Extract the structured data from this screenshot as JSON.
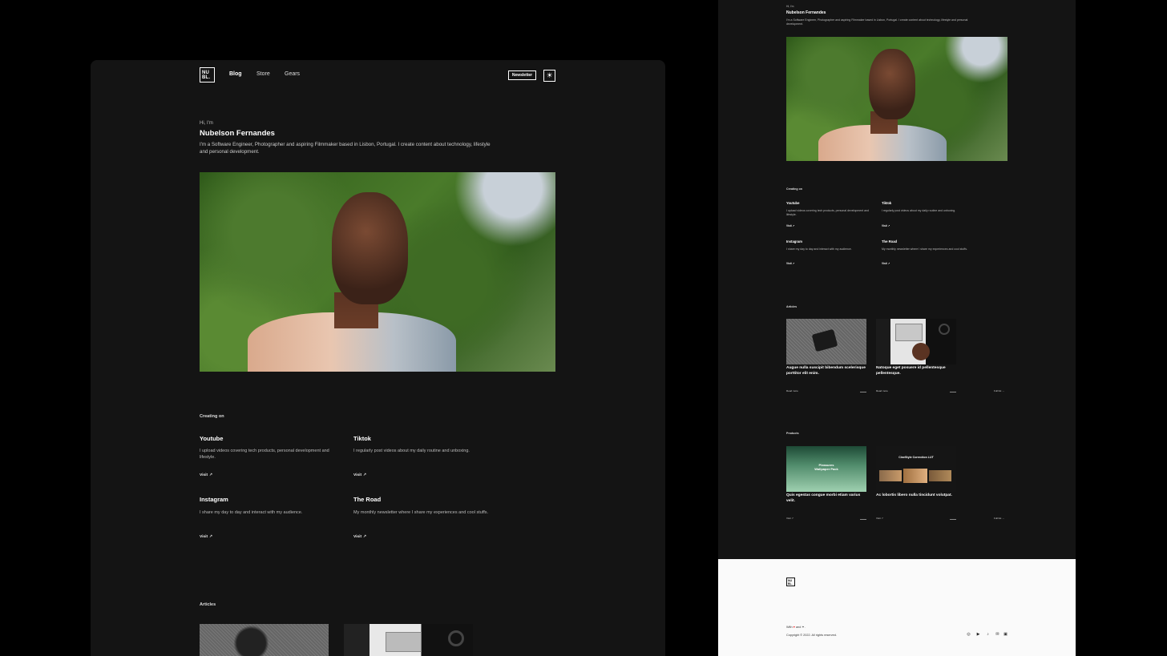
{
  "nav": {
    "logo_text": "NU\nBL.",
    "links": [
      "Blog",
      "Store",
      "Gears"
    ],
    "newsletter_label": "Newsletter",
    "theme_icon": "sun-icon"
  },
  "hero": {
    "greeting": "Hi, I'm",
    "name": "Nubelson Fernandes",
    "bio": "I'm a Software Engineer, Photographer and aspiring Filmmaker based in Lisbon, Portugal. I create content about technology, lifestyle and personal development."
  },
  "creating": {
    "label": "Creating on",
    "cards": [
      {
        "title": "Youtube",
        "desc": "I upload videos covering tech products, personal development and lifestyle.",
        "visit": "Visit"
      },
      {
        "title": "Tiktok",
        "desc": "I regularly post videos about my daily routine and unboxing.",
        "visit": "Visit"
      },
      {
        "title": "Instagram",
        "desc": "I share my day to day and interact with my audience.",
        "visit": "Visit"
      },
      {
        "title": "The Road",
        "desc": "My monthly newsletter where I share my experiences and cool stuffs.",
        "visit": "Visit"
      }
    ]
  },
  "articles": {
    "label": "Articles",
    "items": [
      {
        "title": "Augue nulla suscipit bibendum scelerisque porttitor elit enim.",
        "read": "Read more"
      },
      {
        "title": "Natoque eget posuere id pellentesque pellentesque.",
        "read": "Read more"
      }
    ],
    "full_list": "Full list →"
  },
  "products": {
    "label": "Products",
    "items": [
      {
        "title": "Quis egestas congue morbi etiam varius velit.",
        "thumb_text": "Pleasures\nWallpaper Pack",
        "visit": "Visit"
      },
      {
        "title": "Ac lobortis libero nulla tincidunt volutpat.",
        "thumb_text": "CineStyle Correction LUT",
        "visit": "Visit"
      }
    ],
    "full_list": "Full list →"
  },
  "footer": {
    "logo_text": "NU\nBL.",
    "made_with_prefix": "With",
    "made_with_suffix": "and",
    "copyright": "Copyright © 2022. All rights reserved.",
    "socials": [
      "instagram-icon",
      "youtube-icon",
      "tiktok-icon",
      "newsletter-icon",
      "twitch-icon"
    ]
  },
  "colors": {
    "background": "#000000",
    "panel": "#141414",
    "footer_bg": "#fafafa",
    "text": "#ffffff",
    "muted": "#bbbbbb",
    "heart": "#e33333"
  }
}
